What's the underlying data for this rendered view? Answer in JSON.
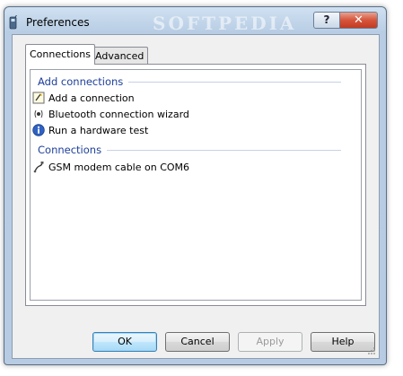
{
  "window": {
    "title": "Preferences",
    "watermark": "SOFTPEDIA",
    "help_glyph": "?",
    "close_glyph": "✕"
  },
  "tabs": [
    {
      "label": "Connections",
      "selected": true
    },
    {
      "label": "Advanced",
      "selected": false
    }
  ],
  "groups": {
    "add": {
      "header": "Add connections",
      "items": [
        {
          "label": "Add a connection",
          "icon": "wizard-icon"
        },
        {
          "label": "Bluetooth connection wizard",
          "icon": "bluetooth-icon"
        },
        {
          "label": "Run a hardware test",
          "icon": "info-icon"
        }
      ]
    },
    "existing": {
      "header": "Connections",
      "items": [
        {
          "label": "GSM modem cable on COM6",
          "icon": "cable-icon"
        }
      ]
    }
  },
  "buttons": {
    "ok": "OK",
    "cancel": "Cancel",
    "apply": "Apply",
    "help": "Help"
  },
  "colors": {
    "group_header": "#1e3f9a",
    "title_bar": "#b8cde4",
    "close_button": "#c23a20"
  }
}
